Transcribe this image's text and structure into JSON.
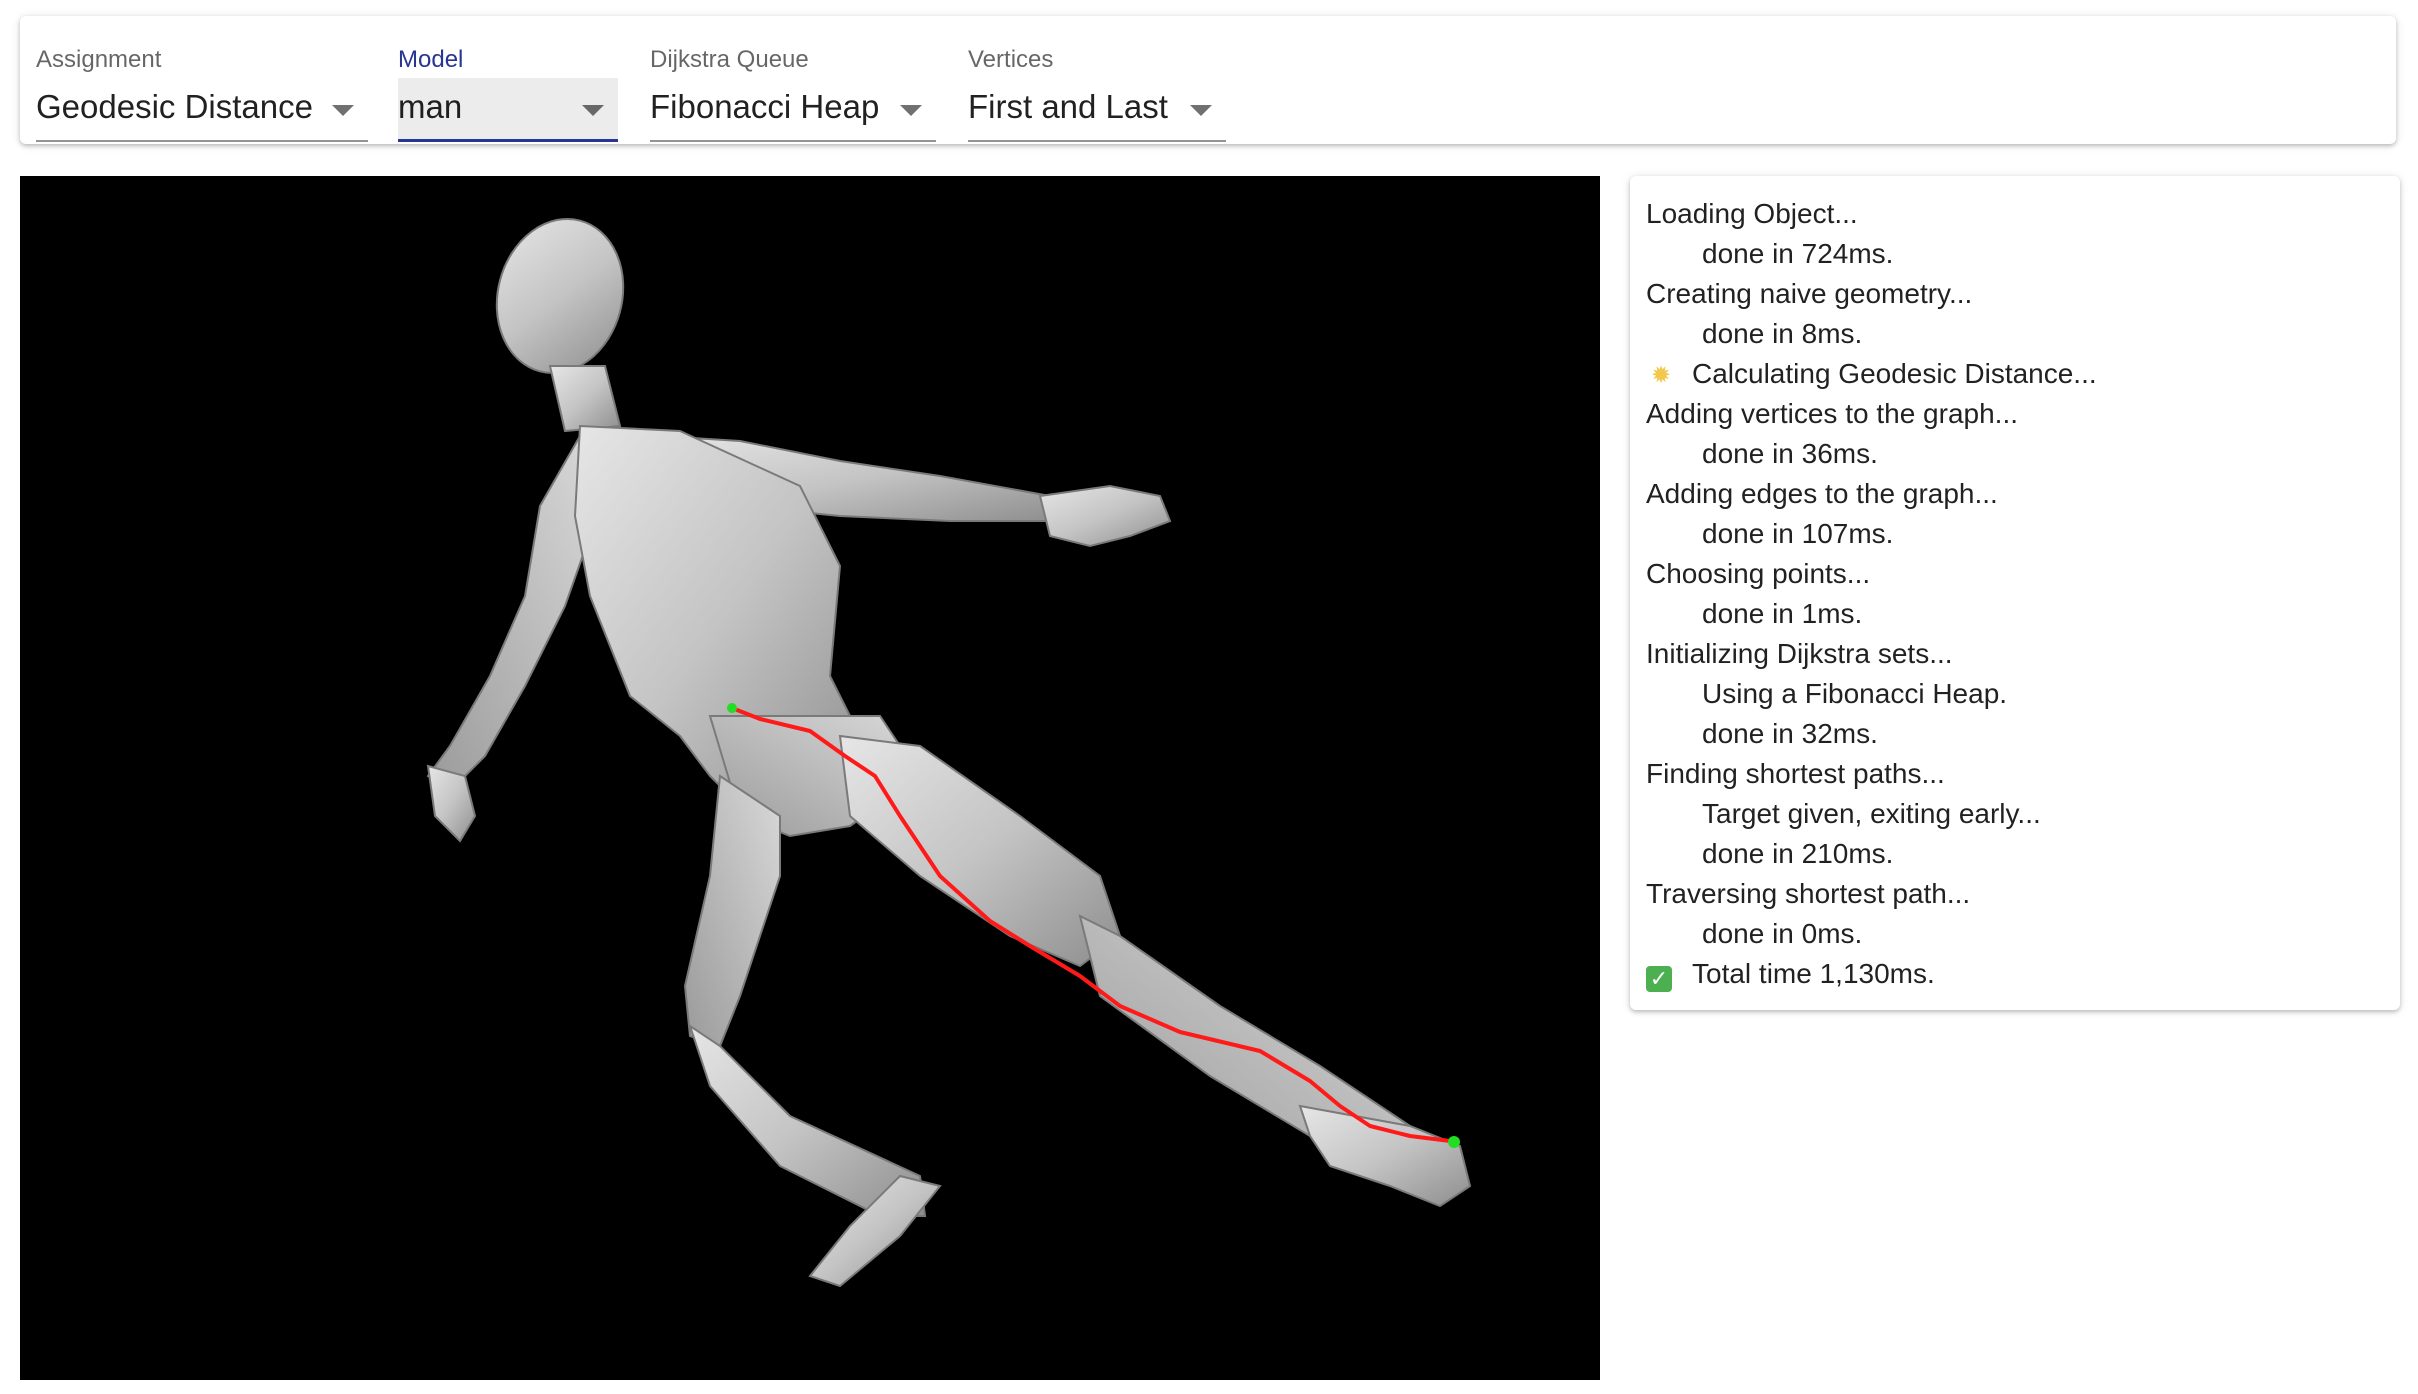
{
  "controls": {
    "assignment": {
      "label": "Assignment",
      "value": "Geodesic Distance"
    },
    "model": {
      "label": "Model",
      "value": "man"
    },
    "dijkstra_queue": {
      "label": "Dijkstra Queue",
      "value": "Fibonacci Heap"
    },
    "vertices": {
      "label": "Vertices",
      "value": "First and Last"
    }
  },
  "viewport": {
    "background_color": "#000000",
    "model_color": "#c8c8c8",
    "path_color": "#ff1a1a",
    "endpoint_color": "#22dd22"
  },
  "log": {
    "lines": [
      {
        "text": "Loading Object...",
        "indent": false,
        "icon": ""
      },
      {
        "text": "done in 724ms.",
        "indent": true,
        "icon": ""
      },
      {
        "text": "Creating naive geometry...",
        "indent": false,
        "icon": ""
      },
      {
        "text": "done in 8ms.",
        "indent": true,
        "icon": ""
      },
      {
        "text": "Calculating Geodesic Distance...",
        "indent": false,
        "icon": "star-icon"
      },
      {
        "text": "Adding vertices to the graph...",
        "indent": false,
        "icon": ""
      },
      {
        "text": "done in 36ms.",
        "indent": true,
        "icon": ""
      },
      {
        "text": "Adding edges to the graph...",
        "indent": false,
        "icon": ""
      },
      {
        "text": "done in 107ms.",
        "indent": true,
        "icon": ""
      },
      {
        "text": "Choosing points...",
        "indent": false,
        "icon": ""
      },
      {
        "text": "done in 1ms.",
        "indent": true,
        "icon": ""
      },
      {
        "text": "Initializing Dijkstra sets...",
        "indent": false,
        "icon": ""
      },
      {
        "text": "Using a Fibonacci Heap.",
        "indent": true,
        "icon": ""
      },
      {
        "text": "done in 32ms.",
        "indent": true,
        "icon": ""
      },
      {
        "text": "Finding shortest paths...",
        "indent": false,
        "icon": ""
      },
      {
        "text": "Target given, exiting early...",
        "indent": true,
        "icon": ""
      },
      {
        "text": "done in 210ms.",
        "indent": true,
        "icon": ""
      },
      {
        "text": "Traversing shortest path...",
        "indent": false,
        "icon": ""
      },
      {
        "text": "done in 0ms.",
        "indent": true,
        "icon": ""
      },
      {
        "text": "Total time 1,130ms.",
        "indent": false,
        "icon": "check-icon"
      }
    ]
  }
}
